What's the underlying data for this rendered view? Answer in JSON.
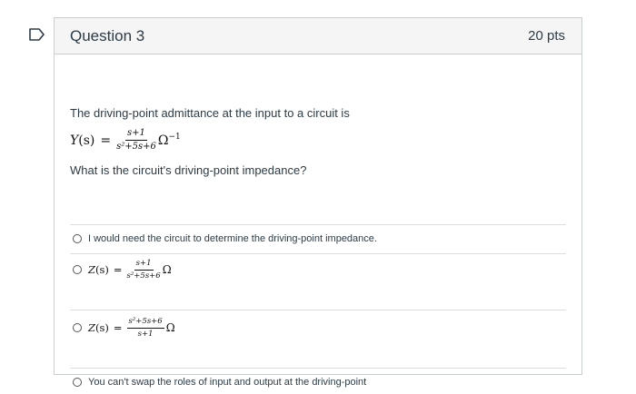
{
  "question": {
    "title": "Question 3",
    "points": "20 pts",
    "prompt": "The driving-point admittance at the input to a circuit is",
    "formula": {
      "lhs_var": "Y",
      "lhs_arg": "(s)",
      "equals": "=",
      "numerator": "s+1",
      "denominator": "s²+5s+6",
      "unit": "Ω",
      "unit_exponent": "−1"
    },
    "followup": "What is the circuit's driving-point impedance?"
  },
  "answers": [
    {
      "text": "I would need the circuit to determine the driving-point impedance."
    },
    {
      "lhs_var": "Z",
      "lhs_arg": "(s)",
      "equals": "=",
      "numerator": "s+1",
      "denominator": "s²+5s+6",
      "unit": "Ω"
    },
    {
      "lhs_var": "Z",
      "lhs_arg": "(s)",
      "equals": "=",
      "numerator": "s²+5s+6",
      "denominator": "s+1",
      "unit": "Ω"
    },
    {
      "text": "You can't swap the roles of input and output at the driving-point"
    }
  ],
  "icons": {
    "flag": "flag-bookmark-icon",
    "radio": "radio-unchecked-icon"
  },
  "colors": {
    "flag_stroke": "#2d3b45",
    "header_bg": "#f5f5f5",
    "border": "#c7cdd1",
    "text": "#2d3b45"
  }
}
